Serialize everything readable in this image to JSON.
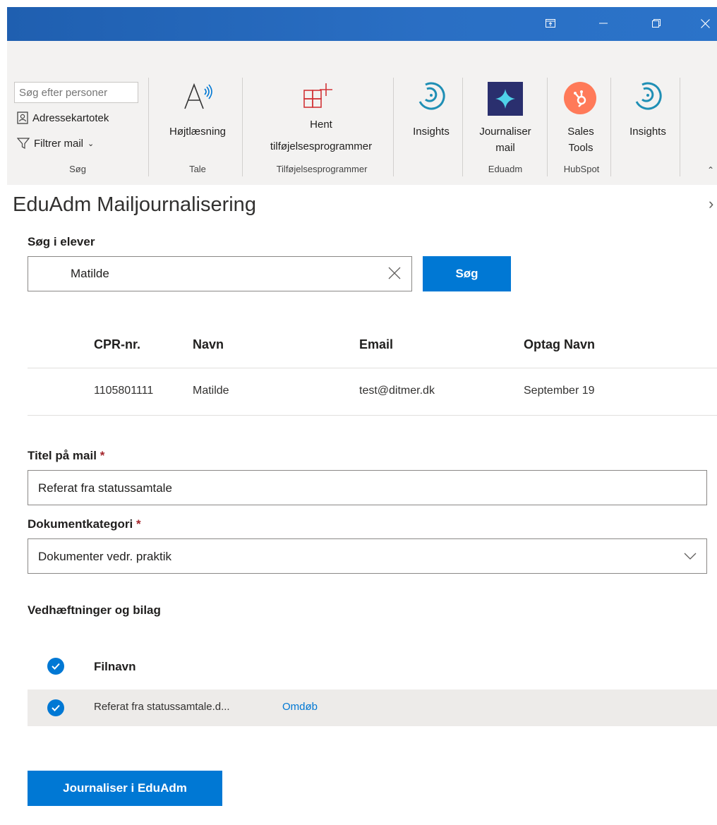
{
  "ribbon": {
    "search_placeholder": "Søg efter personer",
    "address_book": "Adressekartotek",
    "filter_mail": "Filtrer mail",
    "group_search": "Søg",
    "read_aloud": "Højtlæsning",
    "group_speech": "Tale",
    "get_addins_line1": "Hent",
    "get_addins_line2": "tilføjelsesprogrammer",
    "group_addins": "Tilføjelsesprogrammer",
    "insights_1": "Insights",
    "journal_mail_line1": "Journaliser",
    "journal_mail_line2": "mail",
    "group_eduadm": "Eduadm",
    "sales_tools_line1": "Sales",
    "sales_tools_line2": "Tools",
    "group_hubspot": "HubSpot",
    "insights_2": "Insights"
  },
  "pane": {
    "title": "EduAdm Mailjournalisering",
    "search_label": "Søg i elever",
    "search_value": "Matilde",
    "search_button": "Søg",
    "table": {
      "headers": [
        "CPR-nr.",
        "Navn",
        "Email",
        "Optag Navn"
      ],
      "rows": [
        [
          "1105801111",
          "Matilde",
          "test@ditmer.dk",
          "September 19"
        ]
      ]
    },
    "title_label": "Titel på mail",
    "title_value": "Referat fra statussamtale",
    "category_label": "Dokumentkategori",
    "category_value": "Dokumenter vedr. praktik",
    "required_mark": "*",
    "attachments_label": "Vedhæftninger og bilag",
    "filename_header": "Filnavn",
    "file_name": "Referat fra statussamtale.d...",
    "rename_link": "Omdøb",
    "submit_button": "Journaliser i EduAdm"
  },
  "colors": {
    "accent": "#0078d4",
    "titlebar": "#2b6fc4",
    "hubspot": "#ff7a59",
    "eduadm_icon_bg": "#2a2f6e",
    "eduadm_icon_star": "#4fd1e8",
    "insights_teal": "#1f8fb5"
  }
}
